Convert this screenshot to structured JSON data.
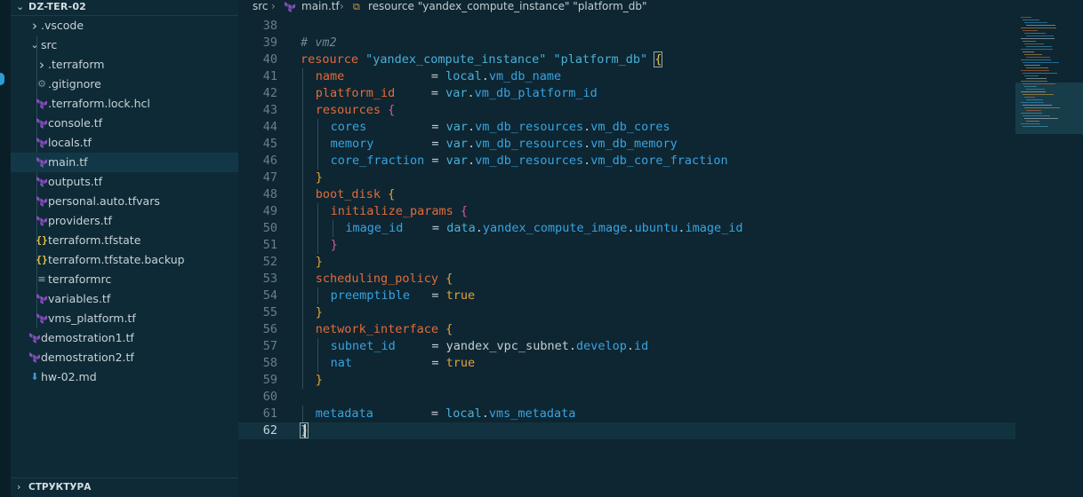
{
  "explorer": {
    "title": "DZ-TER-02",
    "items": [
      {
        "label": ".vscode",
        "icon": "chevron-right-icon",
        "depth": 1
      },
      {
        "label": "src",
        "icon": "chevron-down-icon",
        "depth": 1
      },
      {
        "label": ".terraform",
        "icon": "chevron-right-icon",
        "depth": 2
      },
      {
        "label": ".gitignore",
        "icon": "gear-icon",
        "depth": 2
      },
      {
        "label": ".terraform.lock.hcl",
        "icon": "terraform-icon",
        "depth": 2
      },
      {
        "label": "console.tf",
        "icon": "terraform-icon",
        "depth": 2
      },
      {
        "label": "locals.tf",
        "icon": "terraform-icon",
        "depth": 2
      },
      {
        "label": "main.tf",
        "icon": "terraform-icon",
        "depth": 2,
        "selected": true
      },
      {
        "label": "outputs.tf",
        "icon": "terraform-icon",
        "depth": 2
      },
      {
        "label": "personal.auto.tfvars",
        "icon": "terraform-icon",
        "depth": 2
      },
      {
        "label": "providers.tf",
        "icon": "terraform-icon",
        "depth": 2
      },
      {
        "label": "terraform.tfstate",
        "icon": "braces-icon",
        "depth": 2
      },
      {
        "label": "terraform.tfstate.backup",
        "icon": "braces-icon",
        "depth": 2
      },
      {
        "label": "terraformrc",
        "icon": "lines-icon",
        "depth": 2
      },
      {
        "label": "variables.tf",
        "icon": "terraform-icon",
        "depth": 2
      },
      {
        "label": "vms_platform.tf",
        "icon": "terraform-icon",
        "depth": 2
      },
      {
        "label": "demostration1.tf",
        "icon": "terraform-icon",
        "depth": 1
      },
      {
        "label": "demostration2.tf",
        "icon": "terraform-icon",
        "depth": 1
      },
      {
        "label": "hw-02.md",
        "icon": "markdown-download-icon",
        "depth": 1
      }
    ],
    "footer": "СТРУКТУРА"
  },
  "breadcrumb": {
    "folder": "src",
    "file": "main.tf",
    "symbol": "resource \"yandex_compute_instance\" \"platform_db\""
  },
  "code": {
    "current_line": 62,
    "lines": [
      {
        "n": "38",
        "tokens": []
      },
      {
        "n": "39",
        "tokens": [
          {
            "t": "# vm2",
            "c": "cm"
          }
        ]
      },
      {
        "n": "40",
        "tokens": [
          {
            "t": "resource ",
            "c": "kw"
          },
          {
            "t": "\"yandex_compute_instance\"",
            "c": "str"
          },
          {
            "t": " ",
            "c": ""
          },
          {
            "t": "\"platform_db\"",
            "c": "str"
          },
          {
            "t": " ",
            "c": ""
          },
          {
            "t": "{",
            "c": "b1 bmatch"
          }
        ]
      },
      {
        "n": "41",
        "indent": 1,
        "tokens": [
          {
            "t": "name",
            "c": "kw"
          },
          {
            "t": "            = ",
            "c": "eq"
          },
          {
            "t": "local",
            "c": "ref"
          },
          {
            "t": ".",
            "c": "dot"
          },
          {
            "t": "vm_db_name",
            "c": "attr"
          }
        ]
      },
      {
        "n": "42",
        "indent": 1,
        "tokens": [
          {
            "t": "platform_id",
            "c": "kw"
          },
          {
            "t": "     = ",
            "c": "eq"
          },
          {
            "t": "var",
            "c": "ref"
          },
          {
            "t": ".",
            "c": "dot"
          },
          {
            "t": "vm_db_platform_id",
            "c": "attr"
          }
        ]
      },
      {
        "n": "43",
        "indent": 1,
        "tokens": [
          {
            "t": "resources",
            "c": "kw"
          },
          {
            "t": " ",
            "c": ""
          },
          {
            "t": "{",
            "c": "b2"
          }
        ]
      },
      {
        "n": "44",
        "indent": 2,
        "tokens": [
          {
            "t": "cores",
            "c": "attr"
          },
          {
            "t": "         = ",
            "c": "eq"
          },
          {
            "t": "var",
            "c": "ref"
          },
          {
            "t": ".",
            "c": "dot"
          },
          {
            "t": "vm_db_resources",
            "c": "attr"
          },
          {
            "t": ".",
            "c": "dot"
          },
          {
            "t": "vm_db_cores",
            "c": "attr"
          }
        ]
      },
      {
        "n": "45",
        "indent": 2,
        "tokens": [
          {
            "t": "memory",
            "c": "attr"
          },
          {
            "t": "        = ",
            "c": "eq"
          },
          {
            "t": "var",
            "c": "ref"
          },
          {
            "t": ".",
            "c": "dot"
          },
          {
            "t": "vm_db_resources",
            "c": "attr"
          },
          {
            "t": ".",
            "c": "dot"
          },
          {
            "t": "vm_db_memory",
            "c": "attr"
          }
        ]
      },
      {
        "n": "46",
        "indent": 2,
        "tokens": [
          {
            "t": "core_fraction",
            "c": "attr"
          },
          {
            "t": " = ",
            "c": "eq"
          },
          {
            "t": "var",
            "c": "ref"
          },
          {
            "t": ".",
            "c": "dot"
          },
          {
            "t": "vm_db_resources",
            "c": "attr"
          },
          {
            "t": ".",
            "c": "dot"
          },
          {
            "t": "vm_db_core_fraction",
            "c": "attr"
          }
        ]
      },
      {
        "n": "47",
        "indent": 1,
        "tokens": [
          {
            "t": "}",
            "c": "b3"
          }
        ]
      },
      {
        "n": "48",
        "indent": 1,
        "tokens": [
          {
            "t": "boot_disk",
            "c": "kw"
          },
          {
            "t": " ",
            "c": ""
          },
          {
            "t": "{",
            "c": "b3"
          }
        ]
      },
      {
        "n": "49",
        "indent": 2,
        "tokens": [
          {
            "t": "initialize_params",
            "c": "kw"
          },
          {
            "t": " ",
            "c": ""
          },
          {
            "t": "{",
            "c": "b2"
          }
        ]
      },
      {
        "n": "50",
        "indent": 3,
        "tokens": [
          {
            "t": "image_id",
            "c": "attr"
          },
          {
            "t": "    = ",
            "c": "eq"
          },
          {
            "t": "data",
            "c": "ref"
          },
          {
            "t": ".",
            "c": "dot"
          },
          {
            "t": "yandex_compute_image",
            "c": "attr"
          },
          {
            "t": ".",
            "c": "dot"
          },
          {
            "t": "ubuntu",
            "c": "attr"
          },
          {
            "t": ".",
            "c": "dot"
          },
          {
            "t": "image_id",
            "c": "attr"
          }
        ]
      },
      {
        "n": "51",
        "indent": 2,
        "tokens": [
          {
            "t": "}",
            "c": "b2"
          }
        ]
      },
      {
        "n": "52",
        "indent": 1,
        "tokens": [
          {
            "t": "}",
            "c": "b3"
          }
        ]
      },
      {
        "n": "53",
        "indent": 1,
        "tokens": [
          {
            "t": "scheduling_policy",
            "c": "kw"
          },
          {
            "t": " ",
            "c": ""
          },
          {
            "t": "{",
            "c": "b3"
          }
        ]
      },
      {
        "n": "54",
        "indent": 2,
        "tokens": [
          {
            "t": "preemptible",
            "c": "attr"
          },
          {
            "t": "   = ",
            "c": "eq"
          },
          {
            "t": "true",
            "c": "bool"
          }
        ]
      },
      {
        "n": "55",
        "indent": 1,
        "tokens": [
          {
            "t": "}",
            "c": "b3"
          }
        ]
      },
      {
        "n": "56",
        "indent": 1,
        "tokens": [
          {
            "t": "network_interface",
            "c": "kw"
          },
          {
            "t": " ",
            "c": ""
          },
          {
            "t": "{",
            "c": "b3"
          }
        ]
      },
      {
        "n": "57",
        "indent": 2,
        "tokens": [
          {
            "t": "subnet_id",
            "c": "attr"
          },
          {
            "t": "     = ",
            "c": "eq"
          },
          {
            "t": "yandex_vpc_subnet",
            "c": "eq"
          },
          {
            "t": ".",
            "c": "dot"
          },
          {
            "t": "develop",
            "c": "attr"
          },
          {
            "t": ".",
            "c": "dot"
          },
          {
            "t": "id",
            "c": "attr"
          }
        ]
      },
      {
        "n": "58",
        "indent": 2,
        "tokens": [
          {
            "t": "nat",
            "c": "attr"
          },
          {
            "t": "           = ",
            "c": "eq"
          },
          {
            "t": "true",
            "c": "bool"
          }
        ]
      },
      {
        "n": "59",
        "indent": 1,
        "tokens": [
          {
            "t": "}",
            "c": "b3"
          }
        ]
      },
      {
        "n": "60",
        "tokens": []
      },
      {
        "n": "61",
        "indent": 1,
        "tokens": [
          {
            "t": "metadata",
            "c": "attr"
          },
          {
            "t": "        = ",
            "c": "eq"
          },
          {
            "t": "local",
            "c": "ref"
          },
          {
            "t": ".",
            "c": "dot"
          },
          {
            "t": "vms_metadata",
            "c": "attr"
          }
        ]
      },
      {
        "n": "62",
        "tokens": [
          {
            "t": "}",
            "c": "b1 bmatch"
          }
        ]
      }
    ]
  },
  "colors": {
    "terraform_icon": "#844fba",
    "selection": "#123848",
    "accent": "#2f9bd6"
  }
}
